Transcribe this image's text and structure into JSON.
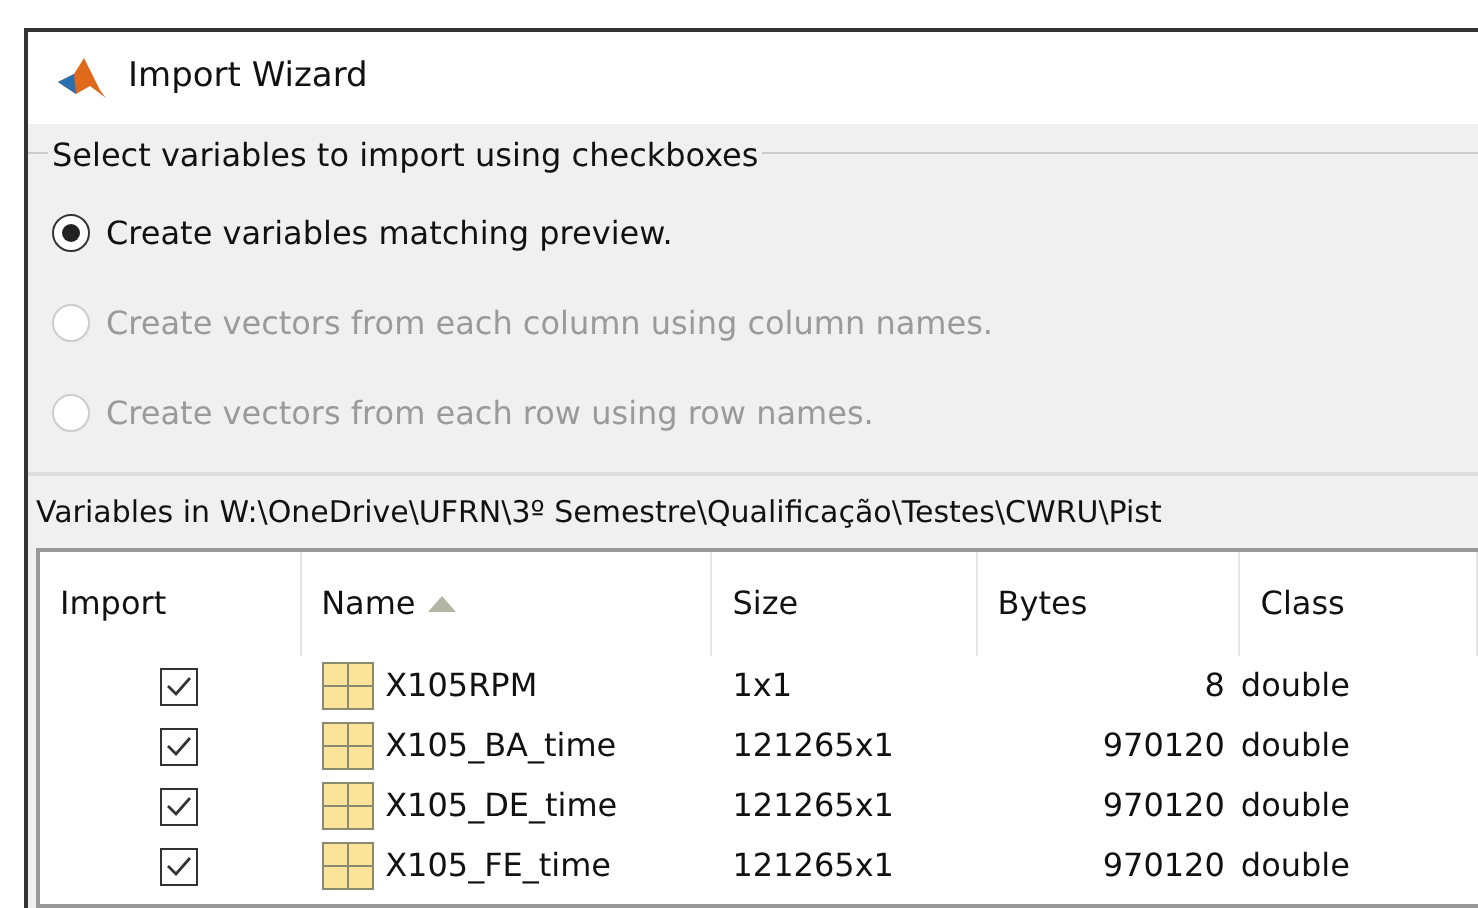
{
  "window": {
    "title": "Import Wizard"
  },
  "group": {
    "label": "Select variables to import using checkboxes"
  },
  "options": [
    {
      "label": "Create variables matching preview.",
      "selected": true,
      "disabled": false
    },
    {
      "label": "Create vectors from each column using column names.",
      "selected": false,
      "disabled": true
    },
    {
      "label": "Create vectors from each row using row names.",
      "selected": false,
      "disabled": true
    }
  ],
  "path_label": "Variables in W:\\OneDrive\\UFRN\\3º Semestre\\Qualificação\\Testes\\CWRU\\Pist",
  "table": {
    "columns": [
      {
        "label": "Import",
        "sorted": false
      },
      {
        "label": "Name",
        "sorted": true
      },
      {
        "label": "Size",
        "sorted": false
      },
      {
        "label": "Bytes",
        "sorted": false
      },
      {
        "label": "Class",
        "sorted": false
      }
    ],
    "rows": [
      {
        "checked": true,
        "name": "X105RPM",
        "size": "1x1",
        "bytes": "8",
        "class": "double"
      },
      {
        "checked": true,
        "name": "X105_BA_time",
        "size": "121265x1",
        "bytes": "970120",
        "class": "double"
      },
      {
        "checked": true,
        "name": "X105_DE_time",
        "size": "121265x1",
        "bytes": "970120",
        "class": "double"
      },
      {
        "checked": true,
        "name": "X105_FE_time",
        "size": "121265x1",
        "bytes": "970120",
        "class": "double"
      }
    ]
  }
}
